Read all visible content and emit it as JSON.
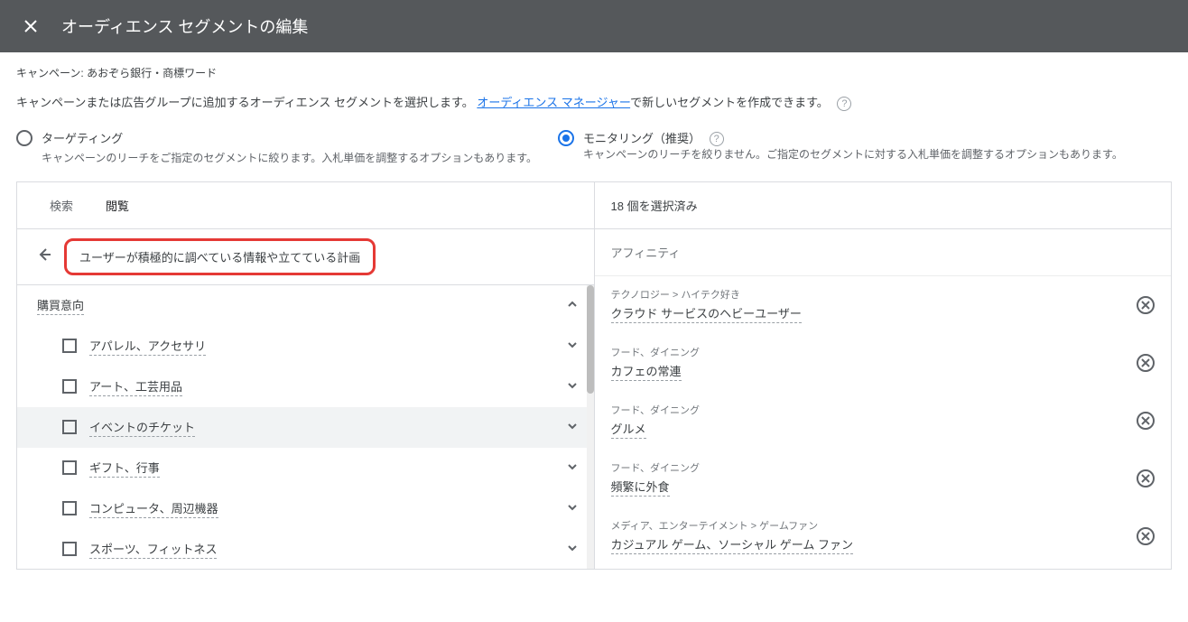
{
  "header": {
    "title": "オーディエンス セグメントの編集"
  },
  "campaign": {
    "label": "キャンペーン: あおぞら銀行・商標ワード"
  },
  "instruction": {
    "prefix": "キャンペーンまたは広告グループに追加するオーディエンス セグメントを選択します。",
    "link": "オーディエンス マネージャー",
    "suffix": "で新しいセグメントを作成できます。"
  },
  "radios": {
    "targeting": {
      "title": "ターゲティング",
      "desc": "キャンペーンのリーチをご指定のセグメントに絞ります。入札単価を調整するオプションもあります。"
    },
    "monitoring": {
      "title": "モニタリング（推奨）",
      "desc": "キャンペーンのリーチを絞りません。ご指定のセグメントに対する入札単価を調整するオプションもあります。"
    }
  },
  "tabs": {
    "search": "検索",
    "browse": "閲覧"
  },
  "selected_count": "18 個を選択済み",
  "breadcrumb": "ユーザーが積極的に調べている情報や立てている計画",
  "category_header": "購買意向",
  "categories": [
    {
      "label": "アパレル、アクセサリ"
    },
    {
      "label": "アート、工芸用品"
    },
    {
      "label": "イベントのチケット"
    },
    {
      "label": "ギフト、行事"
    },
    {
      "label": "コンピュータ、周辺機器"
    },
    {
      "label": "スポーツ、フィットネス"
    }
  ],
  "right_section_title": "アフィニティ",
  "selected_items": [
    {
      "path": "テクノロジー > ハイテク好き",
      "label": "クラウド サービスのヘビーユーザー"
    },
    {
      "path": "フード、ダイニング",
      "label": "カフェの常連"
    },
    {
      "path": "フード、ダイニング",
      "label": "グルメ"
    },
    {
      "path": "フード、ダイニング",
      "label": "頻繁に外食"
    },
    {
      "path": "メディア、エンターテイメント > ゲームファン",
      "label": "カジュアル ゲーム、ソーシャル ゲーム ファン"
    }
  ]
}
